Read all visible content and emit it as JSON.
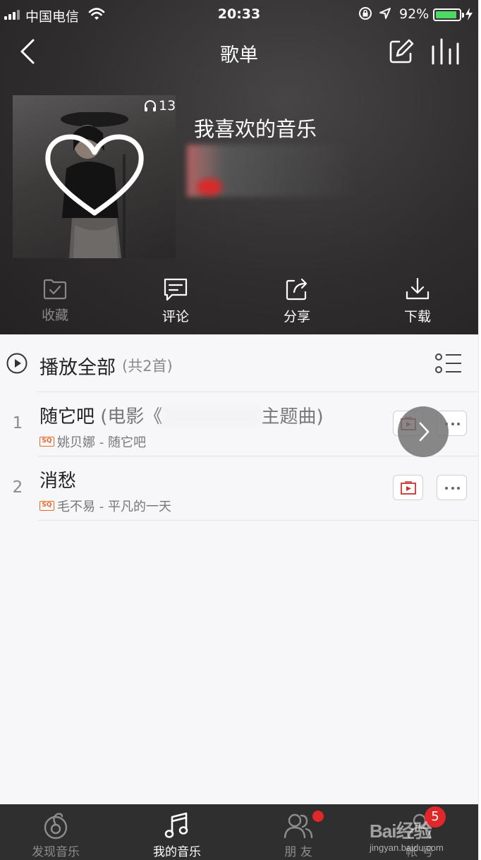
{
  "status_bar": {
    "carrier": "中国电信",
    "time": "20:33",
    "battery_percent": "92%",
    "battery_level": 0.92
  },
  "nav": {
    "title": "歌单",
    "back_icon": "chevron-left-icon",
    "edit_icon": "edit-icon",
    "equalizer_icon": "equalizer-icon"
  },
  "playlist": {
    "play_count": "13",
    "name": "我喜欢的音乐"
  },
  "actions": [
    {
      "label": "收藏",
      "icon": "folder-check-icon",
      "enabled": false
    },
    {
      "label": "评论",
      "icon": "comment-icon",
      "enabled": true
    },
    {
      "label": "分享",
      "icon": "share-icon",
      "enabled": true
    },
    {
      "label": "下载",
      "icon": "download-icon",
      "enabled": true
    }
  ],
  "list": {
    "play_all_label": "播放全部",
    "count_label": "(共2首)",
    "songs": [
      {
        "index": "1",
        "title": "随它吧",
        "subtitle_prefix": "(电影《",
        "subtitle_suffix": "主题曲)",
        "quality_badge": "SQ",
        "artist_album": "姚贝娜 - 随它吧"
      },
      {
        "index": "2",
        "title": "消愁",
        "quality_badge": "SQ",
        "artist_album": "毛不易 - 平凡的一天"
      }
    ]
  },
  "tabbar": {
    "tabs": [
      {
        "label": "发现音乐",
        "icon": "discover-music-icon",
        "active": false
      },
      {
        "label": "我的音乐",
        "icon": "music-note-icon",
        "active": true
      },
      {
        "label": "朋 友",
        "icon": "friends-icon",
        "active": false
      },
      {
        "label": "帐 号",
        "icon": "account-icon",
        "active": false
      }
    ],
    "account_badge": "5"
  },
  "watermark": {
    "logo": "Bai经验",
    "site": "jingyan.baidu.com"
  },
  "colors": {
    "header_bg": "#2f2d2d",
    "list_bg": "#f7f7fa",
    "tabbar_bg": "#2f2f30",
    "accent_red": "#e0282a",
    "sq_orange": "#e8692c"
  }
}
